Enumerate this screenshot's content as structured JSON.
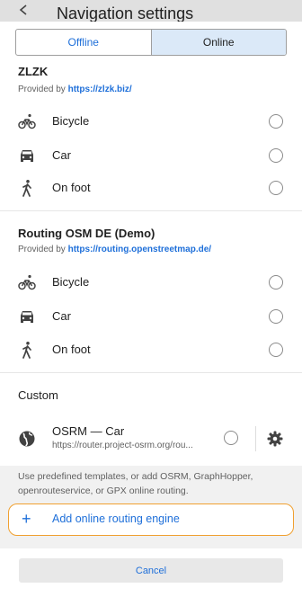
{
  "header": {
    "title": "Navigation settings"
  },
  "tabs": [
    {
      "label": "Offline",
      "active": false
    },
    {
      "label": "Online",
      "active": true
    }
  ],
  "providers": [
    {
      "name": "ZLZK",
      "provided_by": "Provided by",
      "url": "https://zlzk.biz/",
      "modes": [
        {
          "label": "Bicycle",
          "icon": "bicycle-icon"
        },
        {
          "label": "Car",
          "icon": "car-icon"
        },
        {
          "label": "On foot",
          "icon": "walk-icon"
        }
      ]
    },
    {
      "name": "Routing OSM DE (Demo)",
      "provided_by": "Provided by",
      "url": "https://routing.openstreetmap.de/",
      "modes": [
        {
          "label": "Bicycle",
          "icon": "bicycle-icon"
        },
        {
          "label": "Car",
          "icon": "car-icon"
        },
        {
          "label": "On foot",
          "icon": "walk-icon"
        }
      ]
    }
  ],
  "custom": {
    "heading": "Custom",
    "engine": {
      "name": "OSRM — Car",
      "url": "https://router.project-osrm.org/rou..."
    }
  },
  "help_text": "Use predefined templates, or add OSRM, GraphHopper, openrouteservice, or GPX online routing.",
  "add_button": {
    "label": "Add online routing engine",
    "icon": "plus-icon"
  },
  "cancel_button": {
    "label": "Cancel"
  },
  "colors": {
    "accent": "#1e6fd9",
    "highlight_border": "#f0a030",
    "active_tab": "#dbe9f8"
  }
}
